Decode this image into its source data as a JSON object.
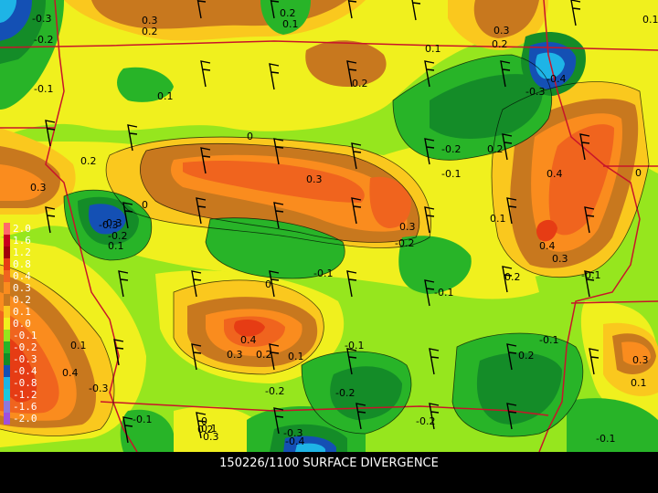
{
  "caption": "150226/1100 SURFACE DIVERGENCE",
  "legend": [
    {
      "label": "2.0",
      "color": "#ff6a6a"
    },
    {
      "label": "1.6",
      "color": "#c8001e"
    },
    {
      "label": "1.2",
      "color": "#a0000a"
    },
    {
      "label": "0.8",
      "color": "#e63c14"
    },
    {
      "label": "0.4",
      "color": "#f0641e"
    },
    {
      "label": "0.3",
      "color": "#fa8c1e"
    },
    {
      "label": "0.2",
      "color": "#c8781e"
    },
    {
      "label": "0.1",
      "color": "#fac81e"
    },
    {
      "label": "0.0",
      "color": "#f0f01e"
    },
    {
      "label": "-0.1",
      "color": "#96e61e"
    },
    {
      "label": "-0.2",
      "color": "#28b428"
    },
    {
      "label": "-0.3",
      "color": "#148c28"
    },
    {
      "label": "-0.4",
      "color": "#1450b4"
    },
    {
      "label": "-0.8",
      "color": "#1eb4e6"
    },
    {
      "label": "-1.2",
      "color": "#1ec8dc"
    },
    {
      "label": "-1.6",
      "color": "#8c78dc"
    },
    {
      "label": "-2.0",
      "color": "#a050dc"
    }
  ],
  "contour_labels": [
    "-0.3",
    "0.3",
    "0.2",
    "0.2",
    "0.1",
    "0.3",
    "0.2",
    "0.1",
    "-0.2",
    "0.1",
    "-0.1",
    "0.1",
    "0.2",
    "-0.4",
    "-0.3",
    "0",
    "0.2",
    "-0.2",
    "0.2",
    "-0.3",
    "0.3",
    "-0.1",
    "0",
    "0.3",
    "0.4",
    "0.1",
    "-0.3",
    "-0.2",
    "0.1",
    "0",
    "0.3",
    "0.4",
    "0.3",
    "-0.2",
    "0.2",
    "-0.1",
    "-0.1",
    "-0.1",
    "-0.2",
    "0.1",
    "0.4",
    "-0.3",
    "0.3",
    "0.2",
    "0.1",
    "-0.1",
    "0.2",
    "0.4",
    "0.3",
    "0.2",
    "-0.1",
    "-0.2",
    "-0.2",
    "0",
    "0.1",
    "-0.1",
    "0",
    "0.1",
    "0.3",
    "-0.3",
    "-0.4",
    "-0.1"
  ]
}
